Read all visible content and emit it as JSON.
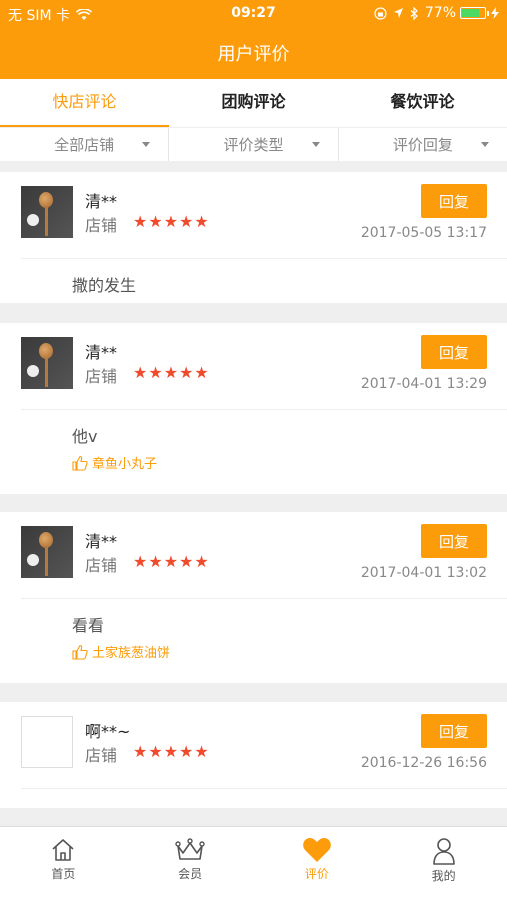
{
  "status_bar": {
    "carrier": "无 SIM 卡",
    "time": "09:27",
    "battery": "77%",
    "battery_level": 0.77
  },
  "header": {
    "title": "用户评价"
  },
  "tabs": [
    {
      "label": "快店评论",
      "active": true
    },
    {
      "label": "团购评论",
      "active": false
    },
    {
      "label": "餐饮评论",
      "active": false
    }
  ],
  "filters": [
    {
      "label": "全部店铺"
    },
    {
      "label": "评价类型"
    },
    {
      "label": "评价回复"
    }
  ],
  "reviews": [
    {
      "user": "清**",
      "shop_label": "店铺",
      "stars": "★★★★★",
      "rating": 5,
      "reply_label": "回复",
      "date": "2017-05-05 13:17",
      "comment": "撒的发生",
      "dish": ""
    },
    {
      "user": "清**",
      "shop_label": "店铺",
      "stars": "★★★★★",
      "rating": 5,
      "reply_label": "回复",
      "date": "2017-04-01 13:29",
      "comment": "他v",
      "dish": "章鱼小丸子"
    },
    {
      "user": "清**",
      "shop_label": "店铺",
      "stars": "★★★★★",
      "rating": 5,
      "reply_label": "回复",
      "date": "2017-04-01 13:02",
      "comment": "看看",
      "dish": "土家族葱油饼"
    },
    {
      "user": "啊**~",
      "shop_label": "店铺",
      "stars": "★★★★★",
      "rating": 5,
      "reply_label": "回复",
      "date": "2016-12-26 16:56",
      "comment": "",
      "dish": ""
    }
  ],
  "bottom_nav": [
    {
      "label": "首页",
      "icon": "home-icon",
      "active": false
    },
    {
      "label": "会员",
      "icon": "crown-icon",
      "active": false
    },
    {
      "label": "评价",
      "icon": "heart-icon",
      "active": true
    },
    {
      "label": "我的",
      "icon": "user-icon",
      "active": false
    }
  ],
  "colors": {
    "accent": "#fd9c0a",
    "star": "#f04b2d"
  }
}
